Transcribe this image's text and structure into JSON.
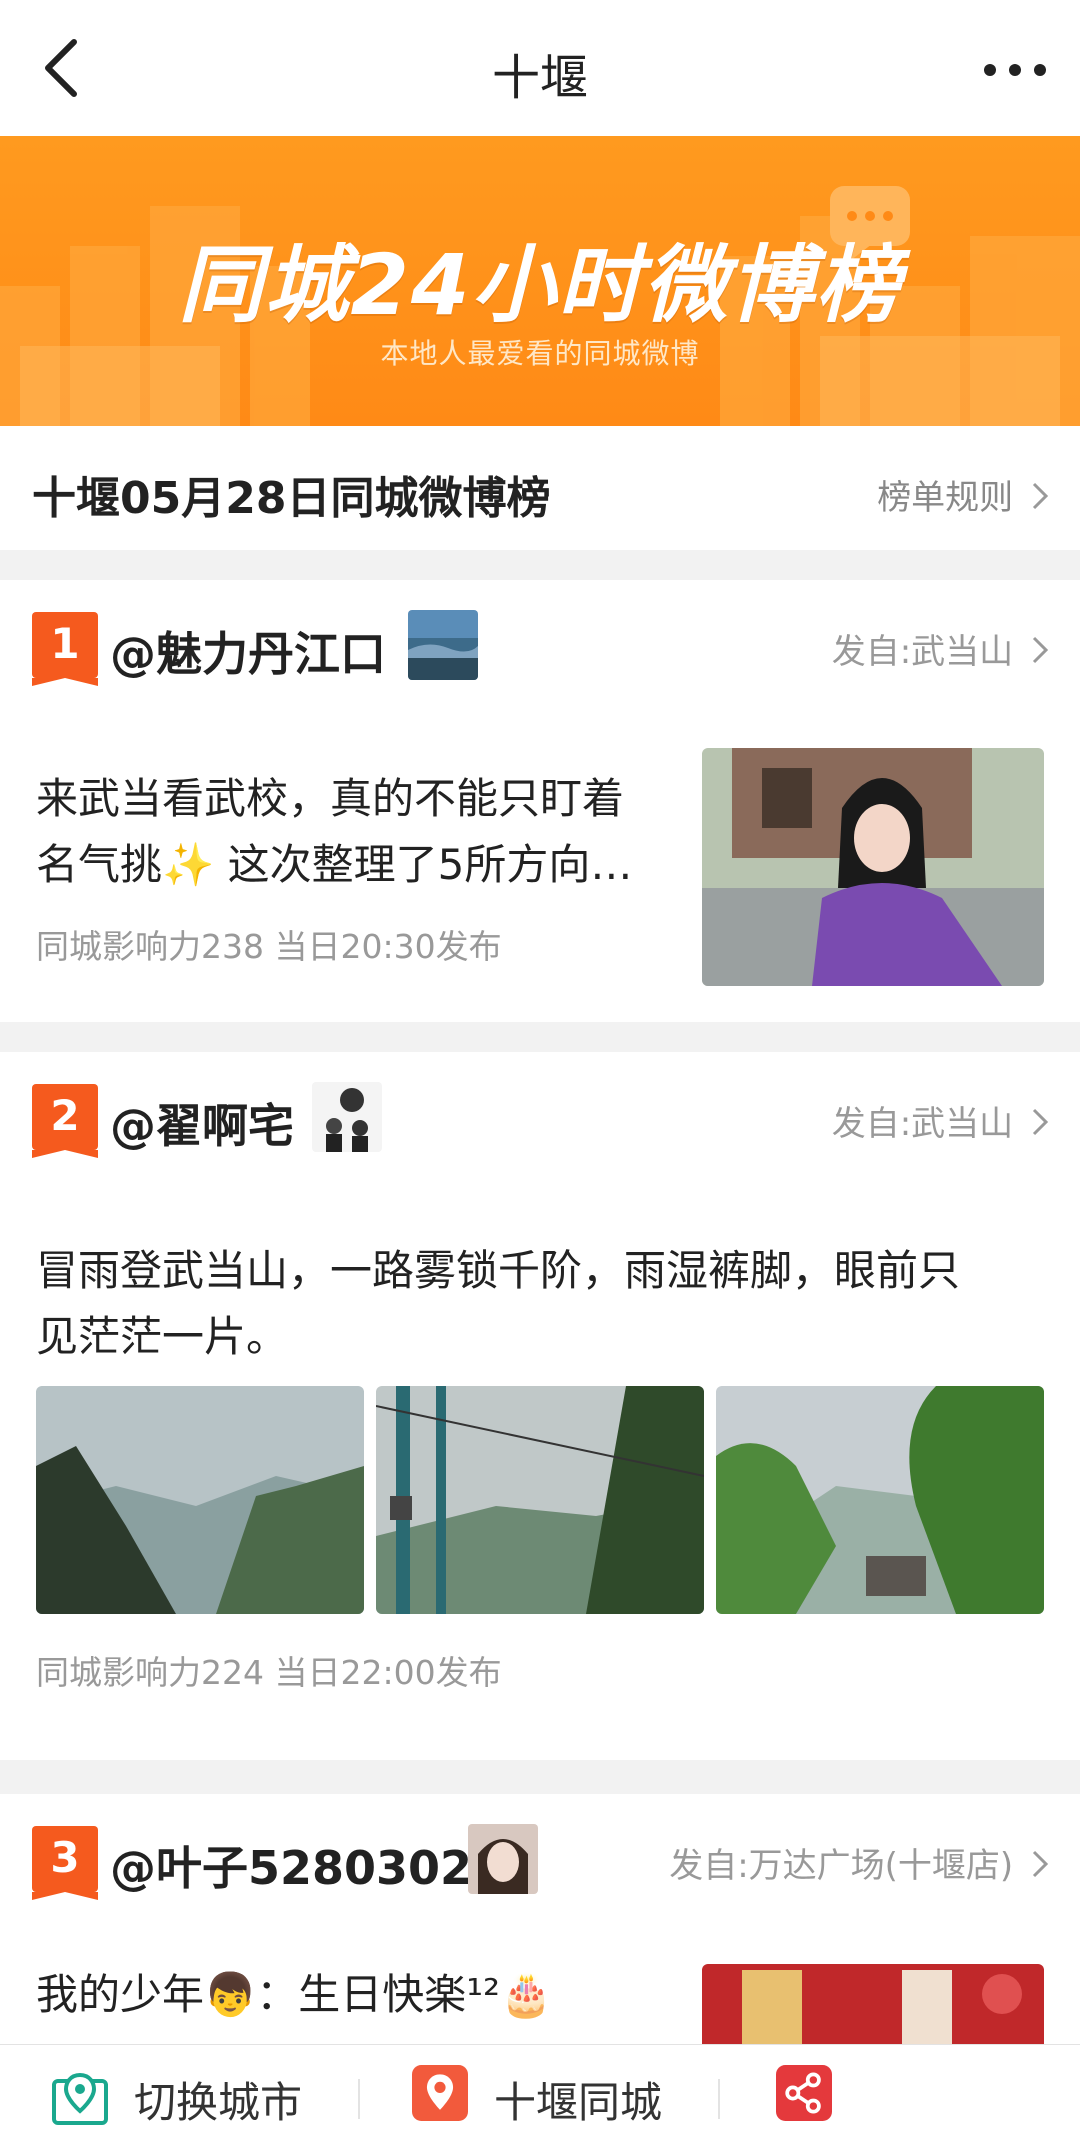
{
  "header": {
    "title": "十堰"
  },
  "banner": {
    "title": "同城24小时微博榜",
    "subtitle": "本地人最爱看的同城微博"
  },
  "section": {
    "title": "十堰05月28日同城微博榜",
    "rules_label": "榜单规则"
  },
  "posts": [
    {
      "rank": "1",
      "user": "@魅力丹江口",
      "from": "发自:武当山",
      "text_line1": "来武当看武校，真的不能只盯着",
      "text_line2": "名气挑✨ 这次整理了5所方向…",
      "meta": "同城影响力238   当日20:30发布"
    },
    {
      "rank": "2",
      "user": "@翟啊宅",
      "from": "发自:武当山",
      "text_line1": "冒雨登武当山，一路雾锁千阶，雨湿裤脚，眼前只",
      "text_line2": "见茫茫一片。",
      "meta": "同城影响力224   当日22:00发布"
    },
    {
      "rank": "3",
      "user": "@叶子5280302",
      "from": "发自:万达广场(十堰店)",
      "text_line1": "我的少年👦：生日快楽¹²🎂"
    }
  ],
  "bottom_bar": {
    "switch_city": "切换城市",
    "local": "十堰同城",
    "share": ""
  },
  "colors": {
    "accent": "#f55a1e",
    "banner": "#ff8a16"
  }
}
